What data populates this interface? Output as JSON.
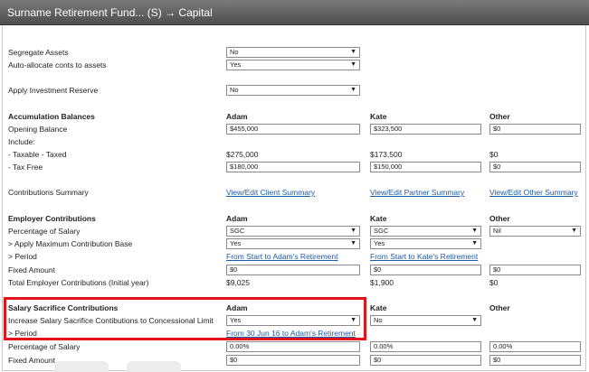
{
  "title": "Surname Retirement Fund... (S) → Capital",
  "segregate_assets": {
    "label": "Segregate Assets",
    "value": "No"
  },
  "auto_allocate": {
    "label": "Auto-allocate conts to assets",
    "value": "Yes"
  },
  "investment_reserve": {
    "label": "Apply Investment Reserve",
    "value": "No"
  },
  "accumulation": {
    "heading": "Accumulation Balances",
    "cols": [
      "Adam",
      "Kate",
      "Other"
    ],
    "opening_label": "Opening Balance",
    "opening": [
      "$455,000",
      "$323,500",
      "$0"
    ],
    "include_label": "Include:",
    "taxable_label": "- Taxable - Taxed",
    "taxable": [
      "$275,000",
      "$173,500",
      "$0"
    ],
    "taxfree_label": "- Tax Free",
    "taxfree": [
      "$180,000",
      "$150,000",
      "$0"
    ]
  },
  "contributions_summary": {
    "label": "Contributions Summary",
    "links": [
      "View/Edit Client Summary",
      "View/Edit Partner Summary",
      "View/Edit Other Summary"
    ]
  },
  "employer": {
    "heading": "Employer Contributions",
    "cols": [
      "Adam",
      "Kate",
      "Other"
    ],
    "pct_label": "Percentage of Salary",
    "pct": [
      "SGC",
      "SGC",
      "Nil"
    ],
    "max_label": "> Apply Maximum Contribution Base",
    "max": [
      "Yes",
      "Yes"
    ],
    "period_label": "> Period",
    "period": [
      "From Start to Adam's Retirement",
      "From Start to Kate's Retirement"
    ],
    "fixed_label": "Fixed Amount",
    "fixed": [
      "$0",
      "$0",
      "$0"
    ],
    "total_label": "Total Employer Contributions (Initial year)",
    "total": [
      "$9,025",
      "$1,900",
      "$0"
    ]
  },
  "salary_sacrifice": {
    "heading": "Salary Sacrifice Contributions",
    "cols": [
      "Adam",
      "Kate",
      "Other"
    ],
    "increase_label": "Increase Salary Sacrifice Contibutions to Concessional Limit",
    "increase": [
      "Yes",
      "No"
    ],
    "period_label": "> Period",
    "period": "From 30 Jun 16 to Adam's Retirement",
    "pct_label": "Percentage of Salary",
    "pct": [
      "0.00%",
      "0.00%",
      "0.00%"
    ],
    "fixed_label": "Fixed Amount",
    "fixed": [
      "$0",
      "$0",
      "$0"
    ]
  },
  "colors": {
    "highlight": "#e0141a",
    "link": "#1d5aa8",
    "titlebar": "#5e5e5e"
  }
}
